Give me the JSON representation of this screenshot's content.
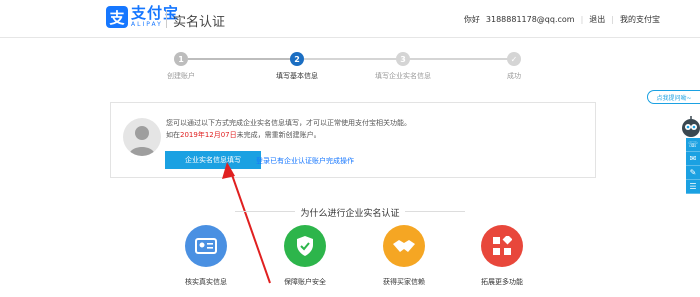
{
  "header": {
    "logo_badge": "支",
    "logo_cn": "支付宝",
    "logo_en": "ALIPAY",
    "page_title": "实名认证",
    "greeting": "你好",
    "email": "3188881178@qq.com",
    "logout": "退出",
    "my_alipay": "我的支付宝"
  },
  "steps": [
    {
      "number": "1",
      "label": "创建账户"
    },
    {
      "number": "2",
      "label": "填写基本信息"
    },
    {
      "number": "3",
      "label": "填写企业实名信息"
    },
    {
      "number": "✓",
      "label": "成功"
    }
  ],
  "info": {
    "line1": "您可以通过以下方式完成企业实名信息填写，才可以正常使用支付宝相关功能。",
    "line2_prefix": "如在",
    "line2_date": "2019年12月07日",
    "line2_suffix": "未完成，需重新创建账户。",
    "primary_button": "企业实名信息填写",
    "link": "登录已有企业认证账户完成操作"
  },
  "why": {
    "title": "为什么进行企业实名认证",
    "features": [
      {
        "label": "核实真实信息",
        "icon": "id-card-icon",
        "color": "#4a90e2"
      },
      {
        "label": "保障账户安全",
        "icon": "shield-icon",
        "color": "#2db54b"
      },
      {
        "label": "获得买家信赖",
        "icon": "handshake-icon",
        "color": "#f5a623"
      },
      {
        "label": "拓展更多功能",
        "icon": "apps-icon",
        "color": "#e8473b"
      }
    ]
  },
  "side": {
    "feedback": "点我提问呦~"
  },
  "colors": {
    "brand": "#1677ff",
    "primary_button": "#1ba1e2",
    "step_done": "#bdbdbd",
    "step_active": "#1b6ec2",
    "arrow": "#e02020"
  }
}
